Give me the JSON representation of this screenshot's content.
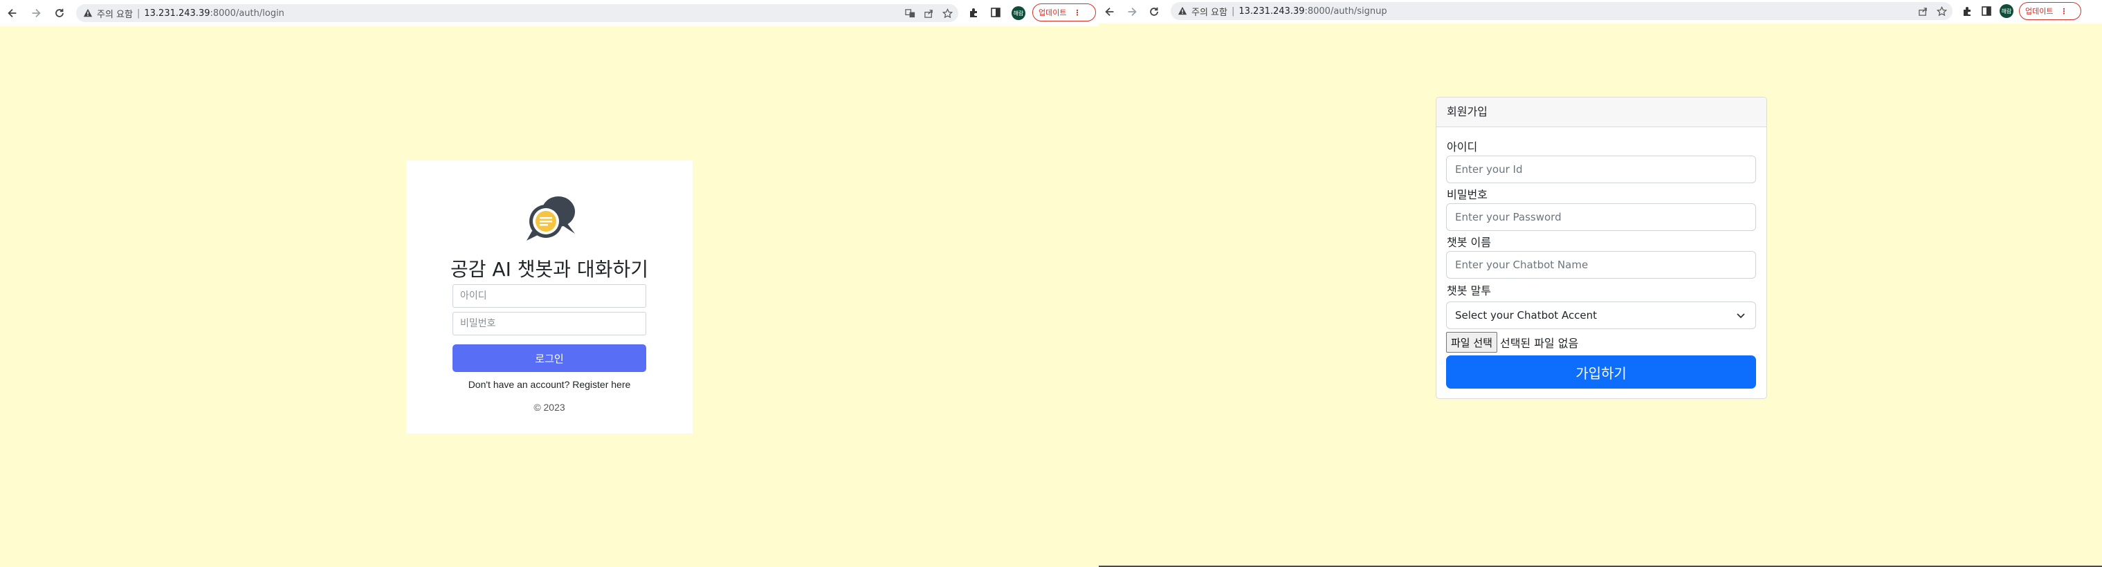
{
  "left_window": {
    "security_warning": "주의 요함",
    "url_host": "13.231.243.39",
    "url_path": ":8000/auth/login",
    "update_label": "업데이트",
    "profile_initials": "해람"
  },
  "login": {
    "title": "공감 AI 챗봇과 대화하기",
    "id_placeholder": "아이디",
    "password_placeholder": "비밀번호",
    "login_button": "로그인",
    "register_text": "Don't have an account? Register here",
    "copyright": "© 2023"
  },
  "right_window": {
    "security_warning": "주의 요함",
    "url_host": "13.231.243.39",
    "url_path": ":8000/auth/signup",
    "update_label": "업데이트",
    "profile_initials": "해람"
  },
  "signup": {
    "header": "회원가입",
    "id_label": "아이디",
    "id_placeholder": "Enter your Id",
    "password_label": "비밀번호",
    "password_placeholder": "Enter your Password",
    "chatbot_name_label": "챗봇 이름",
    "chatbot_name_placeholder": "Enter your Chatbot Name",
    "accent_label": "챗봇 말투",
    "accent_selected": "Select your Chatbot Accent",
    "file_button": "파일 선택",
    "file_status": "선택된 파일 없음",
    "submit_button": "가입하기"
  },
  "colors": {
    "page_background": "#fffdd0",
    "login_button": "#586ff5",
    "submit_button": "#0d6efd",
    "logo_dark": "#3d4551",
    "logo_accent": "#f5c542",
    "update_red": "#d93025"
  }
}
